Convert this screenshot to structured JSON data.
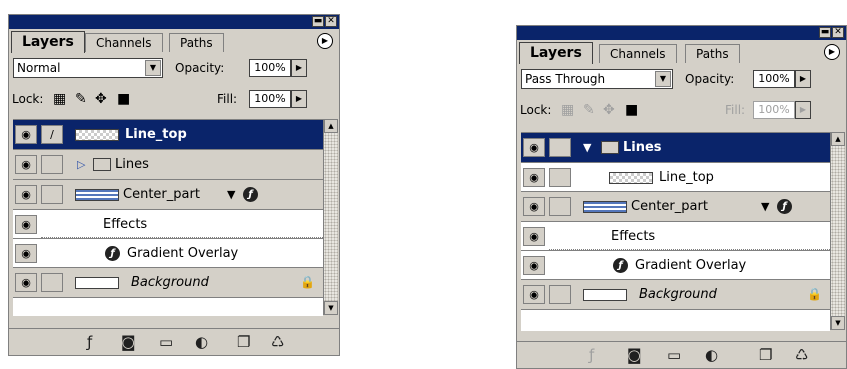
{
  "panels": [
    {
      "tabs": {
        "layers": "Layers",
        "channels": "Channels",
        "paths": "Paths"
      },
      "blend_mode": "Normal",
      "opacity_label": "Opacity:",
      "opacity_value": "100%",
      "lock_label": "Lock:",
      "fill_label": "Fill:",
      "fill_value": "100%",
      "fill_disabled": false,
      "layers": [
        {
          "name": "Line_top",
          "kind": "layer",
          "selected": true
        },
        {
          "name": "Lines",
          "kind": "group-collapsed"
        },
        {
          "name": "Center_part",
          "kind": "layer-with-effects"
        },
        {
          "name": "Effects",
          "kind": "effects-header"
        },
        {
          "name": "Gradient Overlay",
          "kind": "effect"
        },
        {
          "name": "Background",
          "kind": "background",
          "locked": true
        }
      ]
    },
    {
      "tabs": {
        "layers": "Layers",
        "channels": "Channels",
        "paths": "Paths"
      },
      "blend_mode": "Pass Through",
      "opacity_label": "Opacity:",
      "opacity_value": "100%",
      "lock_label": "Lock:",
      "fill_label": "Fill:",
      "fill_value": "100%",
      "fill_disabled": true,
      "layers": [
        {
          "name": "Lines",
          "kind": "group-expanded",
          "selected": true
        },
        {
          "name": "Line_top",
          "kind": "layer-in-group"
        },
        {
          "name": "Center_part",
          "kind": "layer-with-effects"
        },
        {
          "name": "Effects",
          "kind": "effects-header"
        },
        {
          "name": "Gradient Overlay",
          "kind": "effect"
        },
        {
          "name": "Background",
          "kind": "background",
          "locked": true
        }
      ]
    }
  ],
  "glyphs": {
    "eye": "◉",
    "brush": "∕",
    "lock": "🔒",
    "fx": "ƒ",
    "triangle_down": "▼",
    "triangle_right": "▷",
    "minimize": "▬",
    "close": "✕",
    "menu": "▶",
    "dropdown": "▼",
    "stepper": "▶"
  },
  "colors": {
    "panel_bg": "#d4d0c8",
    "selection": "#0a246a",
    "title_bar": "#0a246a"
  }
}
